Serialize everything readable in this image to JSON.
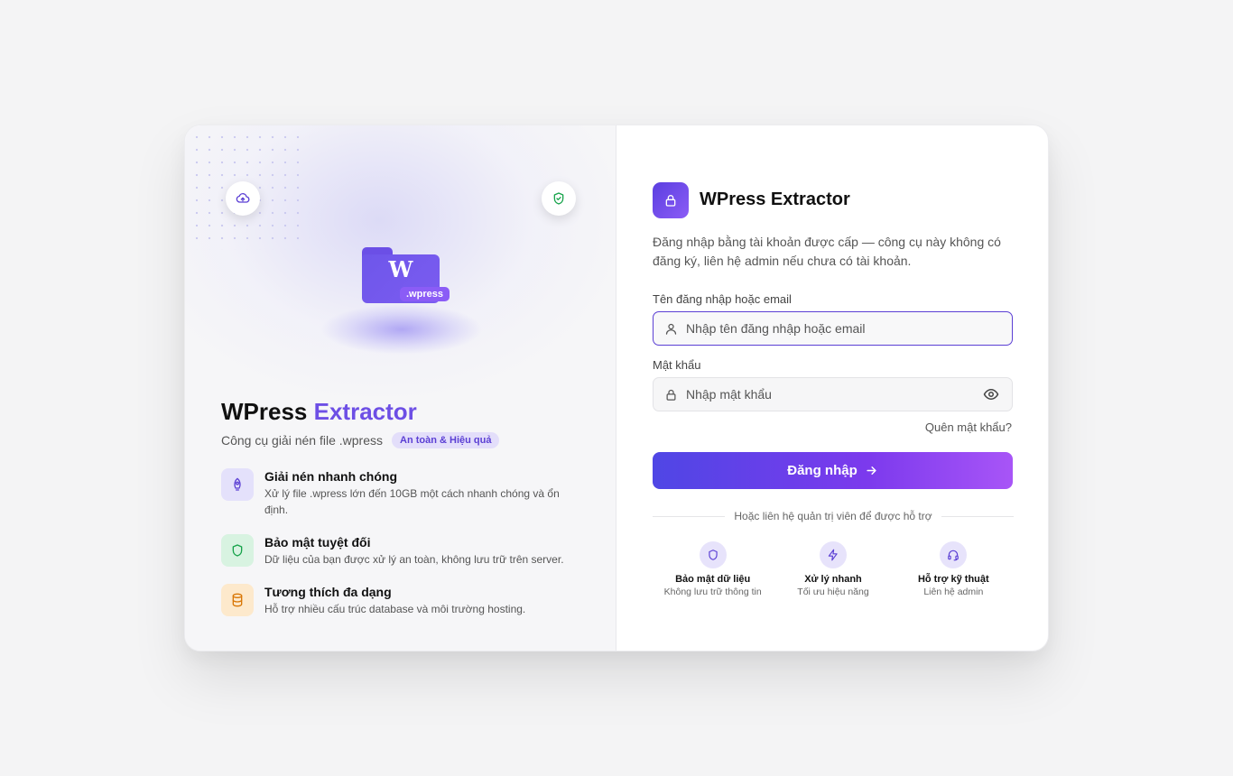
{
  "hero": {
    "folder_letter": "W",
    "folder_ext": ".wpress",
    "title_main": "WPress",
    "title_accent": "Extractor",
    "subtitle": "Công cụ giải nén file .wpress",
    "badge": "An toàn & Hiệu quả",
    "top_icons": [
      "cloud-upload-icon",
      "shield-check-icon"
    ]
  },
  "features": [
    {
      "icon": "rocket-icon",
      "title": "Giải nén nhanh chóng",
      "desc": "Xử lý file .wpress lớn đến 10GB một cách nhanh chóng và ổn định.",
      "icon_bg": "#e4e1fb",
      "icon_color": "#5b3fd4"
    },
    {
      "icon": "shield-icon",
      "title": "Bảo mật tuyệt đối",
      "desc": "Dữ liệu của bạn được xử lý an toàn, không lưu trữ trên server.",
      "icon_bg": "#d8f3e1",
      "icon_color": "#16a34a"
    },
    {
      "icon": "database-icon",
      "title": "Tương thích đa dạng",
      "desc": "Hỗ trợ nhiều cấu trúc database và môi trường hosting.",
      "icon_bg": "#fde9cc",
      "icon_color": "#d97706"
    }
  ],
  "login": {
    "app_title": "WPress Extractor",
    "intro": "Đăng nhập bằng tài khoản được cấp — công cụ này không có đăng ký, liên hệ admin nếu chưa có tài khoản.",
    "username_label": "Tên đăng nhập hoặc email",
    "username_placeholder": "Nhập tên đăng nhập hoặc email",
    "password_label": "Mật khẩu",
    "password_placeholder": "Nhập mật khẩu",
    "forgot": "Quên mật khẩu?",
    "submit": "Đăng nhập",
    "divider_text": "Hoặc liên hệ quản trị viên để được hỗ trợ"
  },
  "support": [
    {
      "icon": "shield-icon",
      "title": "Bảo mật dữ liệu",
      "desc": "Không lưu trữ thông tin"
    },
    {
      "icon": "lightning-icon",
      "title": "Xử lý nhanh",
      "desc": "Tối ưu hiệu năng"
    },
    {
      "icon": "headset-icon",
      "title": "Hỗ trợ kỹ thuật",
      "desc": "Liên hệ admin"
    }
  ],
  "colors": {
    "accent": "#6d4fe5",
    "button_gradient_start": "#4f46e5",
    "button_gradient_end": "#a855f7",
    "page_bg": "#f4f4f5"
  }
}
